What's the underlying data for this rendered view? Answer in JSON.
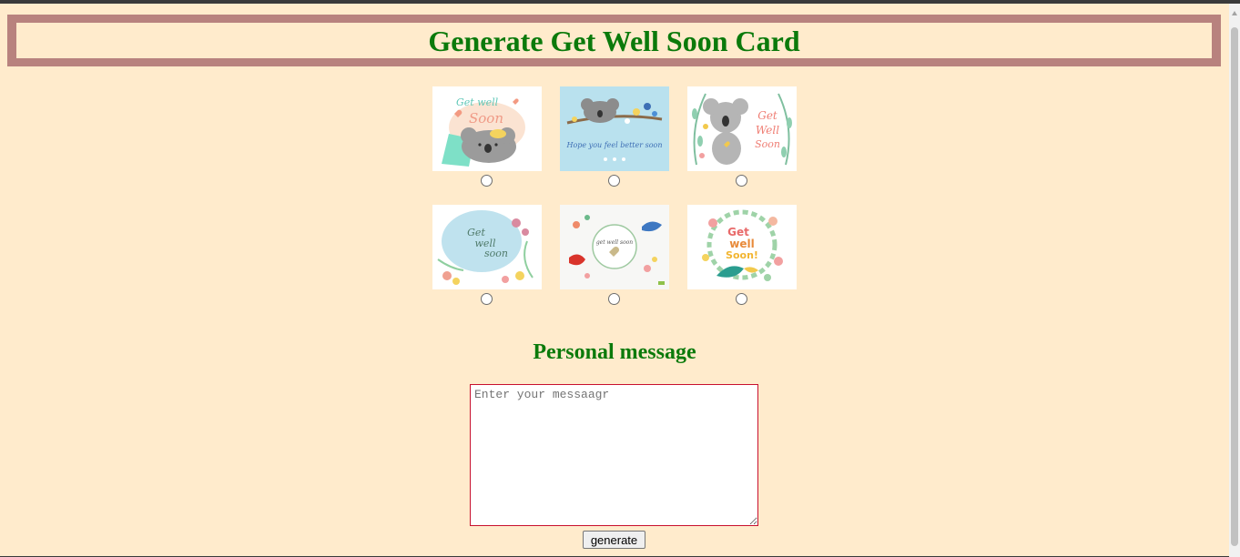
{
  "header": {
    "title": "Generate Get Well Soon Card"
  },
  "cards": [
    {
      "image": "koala-get-well-soon-card",
      "text_lines": [
        "Get well",
        "Soon"
      ]
    },
    {
      "image": "sleeping-koala-branch-card",
      "text_lines": [
        "Hope you feel better soon"
      ]
    },
    {
      "image": "koala-wreath-card",
      "text_lines": [
        "Get",
        "Well",
        "Soon"
      ]
    },
    {
      "image": "watercolor-floral-card",
      "text_lines": [
        "Get",
        "well",
        "soon"
      ]
    },
    {
      "image": "birds-floral-circle-card",
      "text_lines": [
        "get well soon"
      ]
    },
    {
      "image": "bird-wreath-card",
      "text_lines": [
        "Get",
        "well",
        "Soon!"
      ]
    }
  ],
  "message": {
    "title": "Personal message",
    "placeholder": "Enter your messaagr",
    "value": ""
  },
  "generate_button": {
    "label": "generate"
  },
  "colors": {
    "background": "#ffebcc",
    "header_border": "#b8827e",
    "heading": "#0b7a0b",
    "textarea_border": "#c8102e"
  }
}
